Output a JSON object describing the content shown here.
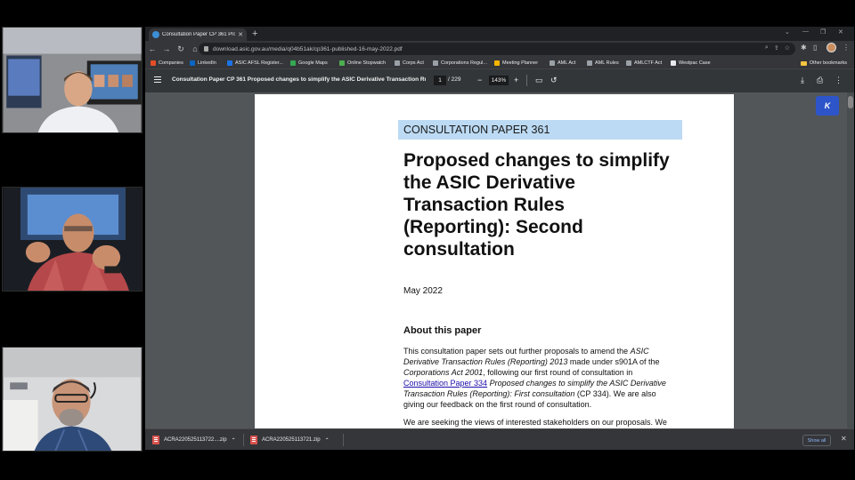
{
  "browser": {
    "tab": {
      "title": "Consultation Paper CP 361 Propo"
    },
    "url": "download.asic.gov.au/media/q04b51ak/cp361-published-16-may-2022.pdf",
    "bookmarks": [
      {
        "label": "Companies",
        "color": "#e44d26"
      },
      {
        "label": "LinkedIn",
        "color": "#0a66c2"
      },
      {
        "label": "ASIC AFSL Register...",
        "color": "#1a73e8"
      },
      {
        "label": "Google Maps",
        "color": "#34a853"
      },
      {
        "label": "Online Stopwatch",
        "color": "#4caf50"
      },
      {
        "label": "Corps Act",
        "color": "#9aa0a6"
      },
      {
        "label": "Corporations Regul...",
        "color": "#9aa0a6"
      },
      {
        "label": "Meeting Planner",
        "color": "#f4b400"
      },
      {
        "label": "AML Act",
        "color": "#9aa0a6"
      },
      {
        "label": "AML Rules",
        "color": "#9aa0a6"
      },
      {
        "label": "AMLCTF Act",
        "color": "#9aa0a6"
      },
      {
        "label": "Westpac Case",
        "color": "#e8eaed"
      }
    ],
    "other_bookmarks": "Other bookmarks"
  },
  "pdf": {
    "title": "Consultation Paper CP 361 Proposed changes to simplify the ASIC Derivative Transaction Rule...",
    "page_current": "1",
    "page_total": "/ 229",
    "zoom": "143%",
    "k_button": "K"
  },
  "document": {
    "banner": "CONSULTATION PAPER 361",
    "title": "Proposed changes to simplify the ASIC Derivative Transaction Rules (Reporting): Second consultation",
    "date": "May 2022",
    "about_heading": "About this paper",
    "about_p1": "This consultation paper sets out further proposals to amend the ",
    "about_i1": "ASIC Derivative Transaction Rules (Reporting) 2013",
    "about_p2": " made under s901A of the ",
    "about_i2": "Corporations Act 2001",
    "about_p3": ", following our first round of consultation in ",
    "about_link": "Consultation Paper 334",
    "about_p4": " ",
    "about_i3": "Proposed changes to simplify the ASIC Derivative Transaction Rules (Reporting): First consultation",
    "about_p5": " (CP 334). We are also giving our feedback on the first round of consultation.",
    "seeking": "We are seeking the views of interested stakeholders on our proposals. We"
  },
  "downloads": {
    "items": [
      "ACRA220525113722....zip",
      "ACRA220525113721.zip"
    ],
    "show_all": "Show all"
  }
}
